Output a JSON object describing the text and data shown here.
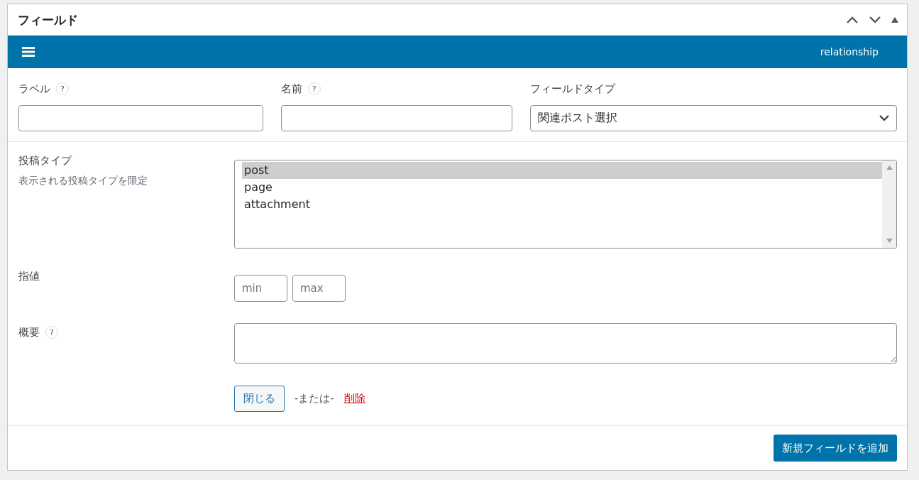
{
  "panel": {
    "title": "フィールド"
  },
  "field_bar": {
    "type_text": "relationship"
  },
  "basic": {
    "label": {
      "label": "ラベル",
      "help": "?"
    },
    "name": {
      "label": "名前",
      "help": "?"
    },
    "field_type": {
      "label": "フィールドタイプ",
      "value": "関連ポスト選択"
    }
  },
  "post_type": {
    "label": "投稿タイプ",
    "description": "表示される投稿タイプを限定",
    "options": [
      {
        "text": "post",
        "selected": true
      },
      {
        "text": "page",
        "selected": false
      },
      {
        "text": "attachment",
        "selected": false
      }
    ]
  },
  "limit": {
    "label": "指値",
    "min_placeholder": "min",
    "max_placeholder": "max"
  },
  "summary": {
    "label": "概要",
    "help": "?"
  },
  "actions": {
    "close": "閉じる",
    "or": "-または-",
    "delete": "削除"
  },
  "footer": {
    "add_button": "新規フィールドを追加"
  }
}
